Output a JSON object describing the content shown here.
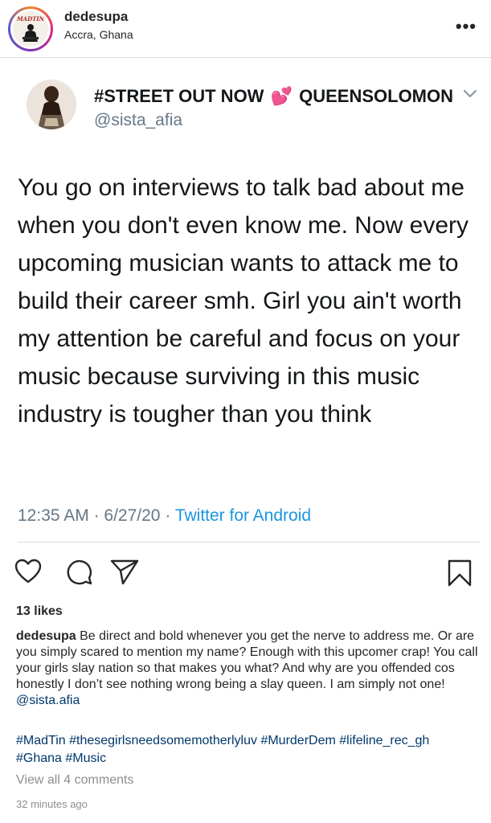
{
  "post_header": {
    "username": "dedesupa",
    "location": "Accra, Ghana",
    "avatar_text": "MADTIN",
    "more_icon": "more-horizontal-icon"
  },
  "tweet": {
    "display_name_part1": "#STREET OUT NOW",
    "heart_emoji": "💕",
    "display_name_part2": "QUEENSOLOMON",
    "handle": "@sista_afia",
    "text": "You go on interviews to talk bad about me when you don't even know me. Now every upcoming musician wants to attack me to build their career smh. Girl you ain't worth my attention be careful and focus on your music because surviving in this music industry is tougher than you think",
    "time": "12:35 AM",
    "date": "6/27/20",
    "separator": "·",
    "source": "Twitter for Android",
    "chevron_icon": "chevron-down-icon"
  },
  "actions": {
    "like_icon": "heart-outline-icon",
    "comment_icon": "comment-icon",
    "share_icon": "paper-plane-icon",
    "save_icon": "bookmark-icon"
  },
  "likes": "13 likes",
  "caption": {
    "username": "dedesupa",
    "text": " Be direct and bold whenever you get the nerve to address me. Or are you simply scared to mention my name? Enough with this upcomer crap! You call your girls slay nation so that makes you what? And why are you offended cos honestly I don’t see nothing wrong being a slay queen. I am simply not one! ",
    "mention": "@sista.afia"
  },
  "hashtags": "#MadTin #thesegirlsneedsomemotherlyluv #MurderDem #lifeline_rec_gh #Ghana #Music",
  "view_comments": "View all 4 comments",
  "time_ago": "32 minutes ago",
  "colors": {
    "twitter_blue": "#1b95e0",
    "twitter_gray": "#657786",
    "ig_link": "#00376b",
    "ig_muted": "#8e8e8e"
  }
}
